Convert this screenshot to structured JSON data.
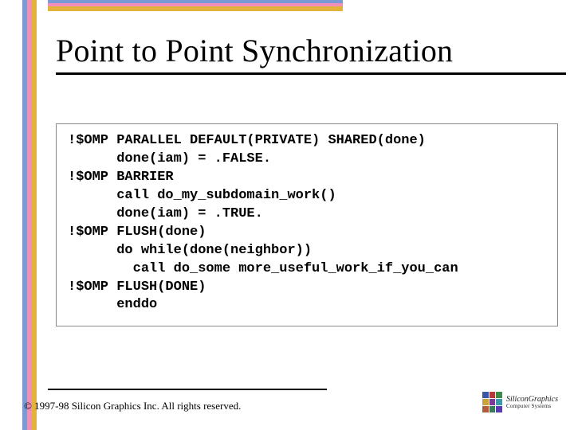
{
  "title": "Point to Point Synchronization",
  "code": {
    "lines": [
      "!$OMP PARALLEL DEFAULT(PRIVATE) SHARED(done)",
      "      done(iam) = .FALSE.",
      "!$OMP BARRIER",
      "      call do_my_subdomain_work()",
      "      done(iam) = .TRUE.",
      "!$OMP FLUSH(done)",
      "      do while(done(neighbor))",
      "        call do_some more_useful_work_if_you_can",
      "!$OMP FLUSH(DONE)",
      "      enddo"
    ]
  },
  "copyright": "© 1997-98 Silicon Graphics Inc. All rights reserved.",
  "logo": {
    "name": "SiliconGraphics",
    "subtitle": "Computer Systems"
  }
}
